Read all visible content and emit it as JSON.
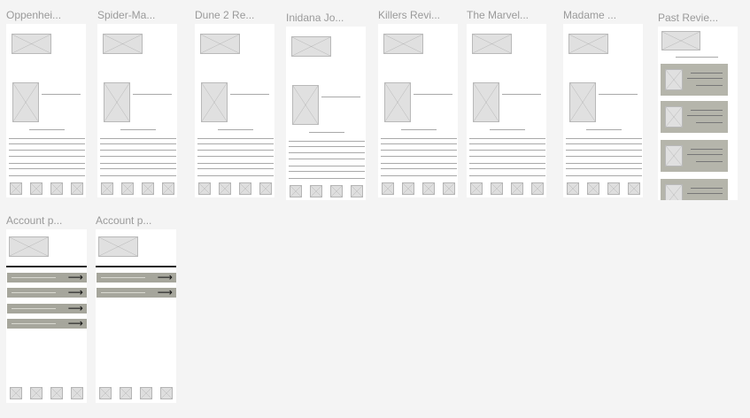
{
  "frames": [
    {
      "label": "Oppenhei..."
    },
    {
      "label": "Spider-Ma..."
    },
    {
      "label": "Dune 2 Re..."
    },
    {
      "label": "Inidana Jo..."
    },
    {
      "label": "Killers Revi..."
    },
    {
      "label": "The Marvel..."
    },
    {
      "label": "Madame ..."
    },
    {
      "label": "Past Revie..."
    },
    {
      "label": "Account p..."
    },
    {
      "label": "Account p..."
    }
  ],
  "arrow_glyph": "⟶",
  "colors": {
    "canvas": "#f4f4f4",
    "frame_bg": "#ffffff",
    "placeholder": "#e0e0e0",
    "review_block": "#b5b5ab",
    "account_bar": "#a6a69c",
    "label_text": "#9a9a9a"
  },
  "icons": [
    "image-placeholder-icon",
    "nav-placeholder-icon",
    "arrow-right-icon"
  ]
}
